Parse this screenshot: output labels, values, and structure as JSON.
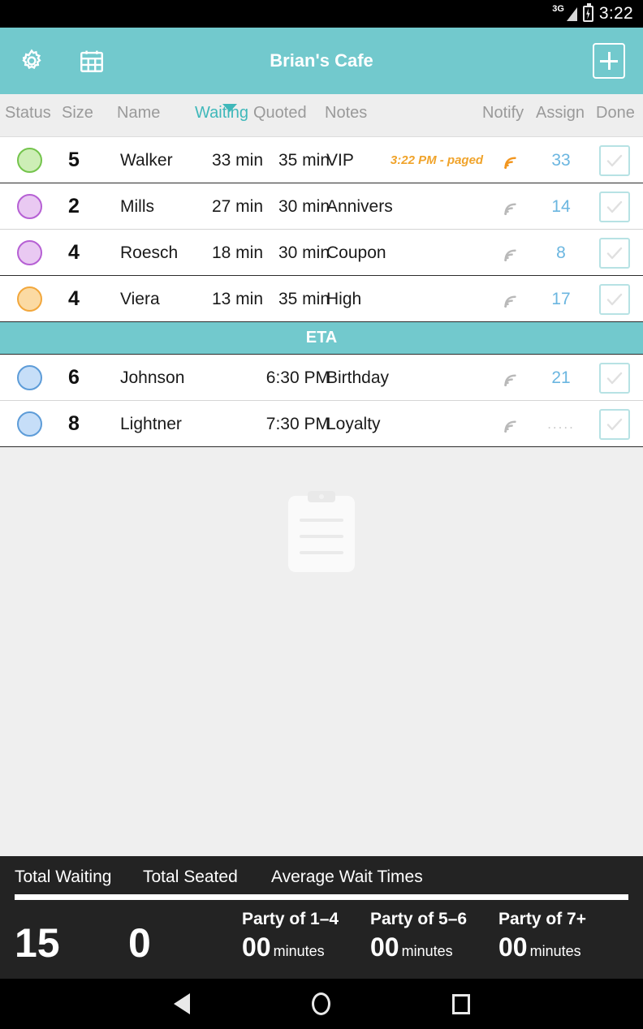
{
  "statusbar": {
    "network": "3G",
    "time": "3:22",
    "signal_icon": "signal-bars-icon",
    "battery_icon": "battery-charging-icon"
  },
  "appbar": {
    "title": "Brian's Cafe",
    "settings_icon": "gear-icon",
    "calendar_icon": "calendar-icon",
    "add_label": "+",
    "background": "#72c9cd"
  },
  "columns": {
    "status": "Status",
    "size": "Size",
    "name": "Name",
    "waiting": "Waiting",
    "quoted": "Quoted",
    "notes": "Notes",
    "notify": "Notify",
    "assign": "Assign",
    "done": "Done",
    "sorted_by": "Waiting",
    "sort_direction": "desc",
    "active_color": "#3fb8ba"
  },
  "waitlist": [
    {
      "status_color": "#cdeeb6",
      "status_border": "#74c44c",
      "size": "5",
      "name": "Walker",
      "waiting": "33 min",
      "quoted": "35 min",
      "notes": "VIP",
      "paged": "3:22 PM - paged",
      "paged_color": "#f0a32a",
      "notify_state": "paged",
      "assign": "33",
      "done": false
    },
    {
      "status_color": "#e9c9f2",
      "status_border": "#b660d4",
      "size": "2",
      "name": "Mills",
      "waiting": "27 min",
      "quoted": "30 min",
      "notes": "Annivers",
      "paged": "",
      "notify_state": "idle",
      "assign": "14",
      "done": false
    },
    {
      "status_color": "#e9c9f2",
      "status_border": "#b660d4",
      "size": "4",
      "name": "Roesch",
      "waiting": "18 min",
      "quoted": "30 min",
      "notes": "Coupon",
      "paged": "",
      "notify_state": "idle",
      "assign": "8",
      "done": false
    },
    {
      "status_color": "#fbdaa3",
      "status_border": "#f2a73c",
      "size": "4",
      "name": "Viera",
      "waiting": "13 min",
      "quoted": "35 min",
      "notes": "High",
      "paged": "",
      "notify_state": "idle",
      "assign": "17",
      "done": false
    }
  ],
  "eta_divider": "ETA",
  "eta_list": [
    {
      "status_color": "#c6def8",
      "status_border": "#5d9cd8",
      "size": "6",
      "name": "Johnson",
      "waiting": "",
      "quoted": "6:30 PM",
      "notes": "Birthday",
      "paged": "",
      "notify_state": "idle",
      "assign": "21",
      "done": false
    },
    {
      "status_color": "#c6def8",
      "status_border": "#5d9cd8",
      "size": "8",
      "name": "Lightner",
      "waiting": "",
      "quoted": "7:30 PM",
      "notes": "Loyalty",
      "paged": "",
      "notify_state": "idle",
      "assign": ".....",
      "done": false
    }
  ],
  "empty_state": {
    "watermark_icon": "clipboard-icon"
  },
  "stats": {
    "total_waiting_label": "Total Waiting",
    "total_seated_label": "Total Seated",
    "average_label": "Average Wait Times",
    "total_waiting_value": "15",
    "total_seated_value": "0",
    "averages": [
      {
        "title": "Party of 1–4",
        "value": "00",
        "unit": "minutes"
      },
      {
        "title": "Party of 5–6",
        "value": "00",
        "unit": "minutes"
      },
      {
        "title": "Party of 7+",
        "value": "00",
        "unit": "minutes"
      }
    ]
  },
  "navbar": {
    "back_icon": "back-triangle-icon",
    "home_icon": "home-circle-icon",
    "recents_icon": "recents-square-icon"
  }
}
